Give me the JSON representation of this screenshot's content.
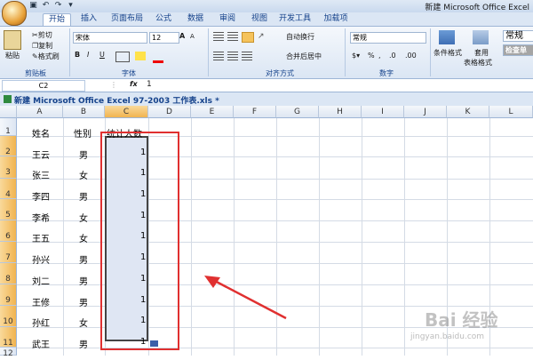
{
  "window": {
    "title": "新建 Microsoft Office Excel"
  },
  "ribbon_tabs": [
    "开始",
    "插入",
    "页面布局",
    "公式",
    "数据",
    "审阅",
    "视图",
    "开发工具",
    "加载项"
  ],
  "clipboard": {
    "paste": "粘贴",
    "cut": "剪切",
    "copy": "复制",
    "format_painter": "格式刷",
    "label": "剪贴板"
  },
  "font": {
    "name": "宋体",
    "size": "12",
    "label": "字体",
    "bold": "B",
    "italic": "I",
    "underline": "U",
    "grow": "A",
    "shrink": "A"
  },
  "alignment": {
    "wrap": "自动换行",
    "merge": "合并后居中",
    "label": "对齐方式"
  },
  "number": {
    "format": "常规",
    "label": "数字",
    "percent": "%",
    "comma": ",",
    "inc": ".0",
    "dec": ".00"
  },
  "styles": {
    "conditional": "条件格式",
    "table": "套用",
    "table2": "表格格式",
    "normal": "常规",
    "check": "检查单"
  },
  "formula_bar": {
    "name_box": "C2",
    "fx": "fx",
    "value": "1"
  },
  "doc_tab": "新建 Microsoft Office Excel 97-2003 工作表.xls *",
  "columns": [
    "A",
    "B",
    "C",
    "D",
    "E",
    "F",
    "G",
    "H",
    "I",
    "J",
    "K",
    "L"
  ],
  "rows": [
    "1",
    "2",
    "3",
    "4",
    "5",
    "6",
    "7",
    "8",
    "9",
    "10",
    "11",
    "12"
  ],
  "table": {
    "headers": [
      "姓名",
      "性别",
      "统计人数"
    ],
    "rows": [
      [
        "王云",
        "男",
        "1"
      ],
      [
        "张三",
        "女",
        "1"
      ],
      [
        "李四",
        "男",
        "1"
      ],
      [
        "李希",
        "女",
        "1"
      ],
      [
        "王五",
        "女",
        "1"
      ],
      [
        "孙兴",
        "男",
        "1"
      ],
      [
        "刘二",
        "男",
        "1"
      ],
      [
        "王修",
        "男",
        "1"
      ],
      [
        "孙红",
        "女",
        "1"
      ],
      [
        "武王",
        "男",
        "1"
      ]
    ]
  },
  "watermark": {
    "main": "Bai 经验",
    "sub": "jingyan.baidu.com"
  },
  "colors": {
    "selection": "#dfe6f3",
    "highlight_box": "#e03030",
    "header_selected": "#f1b450"
  }
}
